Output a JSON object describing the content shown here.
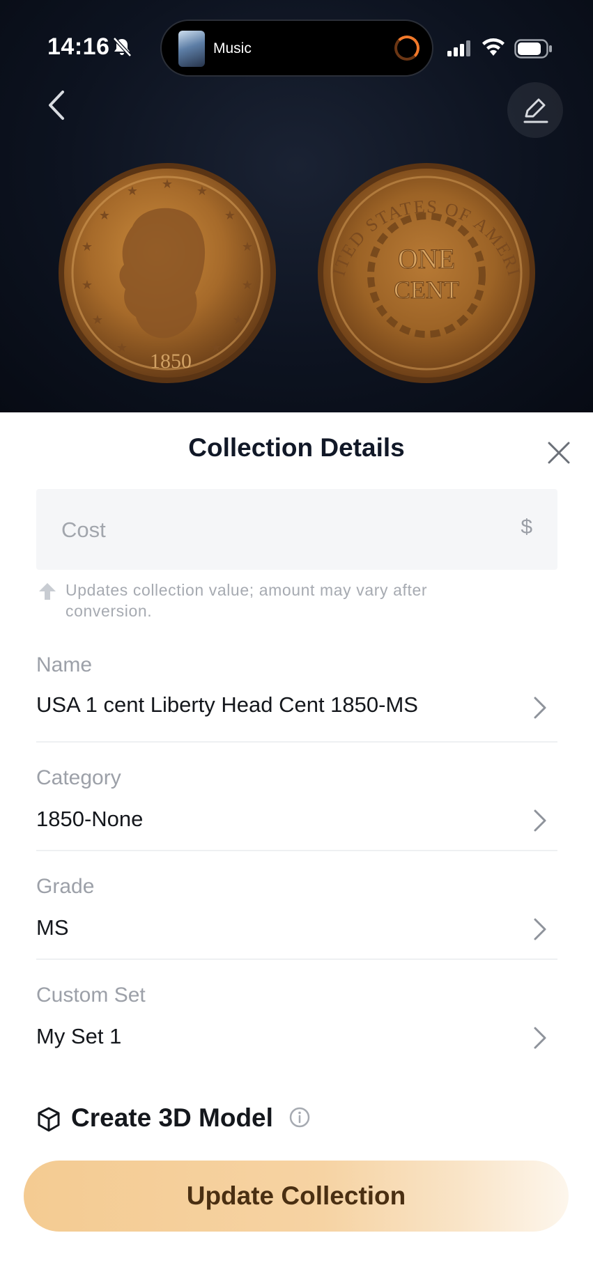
{
  "status_bar": {
    "time": "14:16",
    "now_playing": "Music",
    "icons": [
      "bell-slash-icon",
      "cellular-signal-icon",
      "wifi-icon",
      "battery-icon"
    ]
  },
  "header": {
    "icons": [
      "chevron-left-icon",
      "pencil-edit-icon"
    ]
  },
  "coin": {
    "obverse_year": "1850",
    "reverse_legend_top": "UNITED STATES OF AMERICA",
    "reverse_center_line1": "ONE",
    "reverse_center_line2": "CENT"
  },
  "sheet": {
    "title": "Collection Details",
    "close_icon": "close-x-icon",
    "cost": {
      "placeholder": "Cost",
      "value": "",
      "currency_symbol": "$"
    },
    "hint": "Updates collection value; amount may vary after conversion.",
    "fields": [
      {
        "label": "Name",
        "value": "USA 1 cent  Liberty Head Cent 1850-MS"
      },
      {
        "label": "Category",
        "value": "1850-None"
      },
      {
        "label": "Grade",
        "value": "MS"
      },
      {
        "label": "Custom Set",
        "value": "My Set 1"
      }
    ],
    "create_3d_label": "Create 3D Model",
    "update_button_label": "Update Collection"
  },
  "colors": {
    "hero_background": "#0d1320",
    "button_gradient_start": "#f4cb92",
    "button_text": "#4a2f12",
    "field_background": "#f5f6f8"
  }
}
